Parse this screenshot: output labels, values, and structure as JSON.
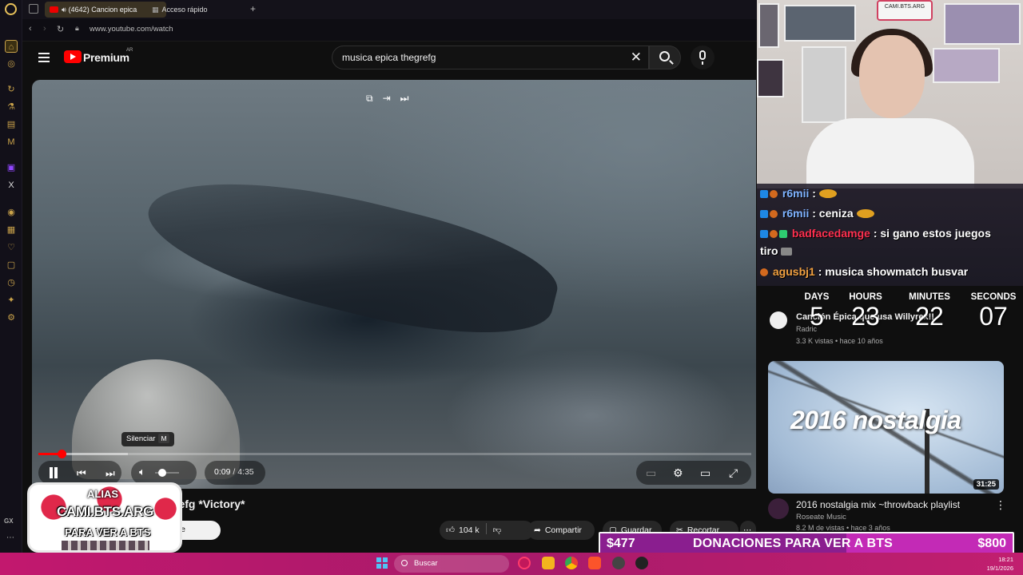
{
  "browser": {
    "tabs": [
      {
        "label": "(4642) Cancion epica"
      },
      {
        "label": "Acceso rápido"
      }
    ],
    "new_tab": "+",
    "url": "www.youtube.com/watch",
    "side_rail_bottom": "GX"
  },
  "youtube": {
    "logo_text": "Premium",
    "region": "AR",
    "search_value": "musica epica thegrefg"
  },
  "player": {
    "tooltip": "Silenciar",
    "tooltip_key": "M",
    "current_time": "0:09",
    "duration": "4:35",
    "time_sep": " / ",
    "progress": 0.033,
    "buffered": 0.126,
    "volume": 0.3
  },
  "video": {
    "title_visible": "refg *Victory*",
    "subscribe_partial": "rse",
    "likes": "104 k",
    "share_label": "Compartir",
    "save_label": "Guardar",
    "clip_label": "Recortar"
  },
  "overlay_alias": {
    "line1": "ALIAS",
    "line2": "CAMI.BTS.ARG",
    "line3": "PARA VER A BTS"
  },
  "webcam": {
    "sign_text": "CAMI.BTS.ARG"
  },
  "chat": [
    {
      "user": "r6mii",
      "message": ":",
      "user_color": "u-blue"
    },
    {
      "user": "r6mii",
      "message": ": ceniza",
      "user_color": "u-blue"
    },
    {
      "user": "badfacedamge",
      "message": ": si gano estos juegos",
      "user_color": "u-red",
      "cont": "tiro"
    },
    {
      "user": "agusbj1",
      "message": ": musica showmatch busvar",
      "user_color": "u-orange"
    }
  ],
  "countdown": {
    "labels": [
      "DAYS",
      "HOURS",
      "MINUTES",
      "SECONDS"
    ],
    "values": [
      "5",
      "23",
      "22",
      "07"
    ]
  },
  "recommendations": [
    {
      "title": "Canción Épica que usa Willyrex!!",
      "channel": "Radric",
      "meta": "3.3 K vistas • hace 10 años"
    },
    {
      "thumb_text": "2016 nostalgia",
      "duration": "31:25",
      "title": "2016 nostalgia mix ~throwback playlist",
      "channel": "Roseate Music",
      "meta": "8.2 M de vistas • hace 3 años"
    }
  ],
  "donation": {
    "current": "$477",
    "text": "DONACIONES PARA VER A BTS",
    "goal": "$800",
    "fraction": 0.596
  },
  "taskbar": {
    "search_label": "Buscar",
    "time": "18:21",
    "date": "19/1/2026"
  },
  "colors": {
    "accent_red": "#ff0000",
    "donation_bar": "#c32ab6",
    "taskbar": "#c2186e",
    "opera_gold": "#c9a24a"
  }
}
